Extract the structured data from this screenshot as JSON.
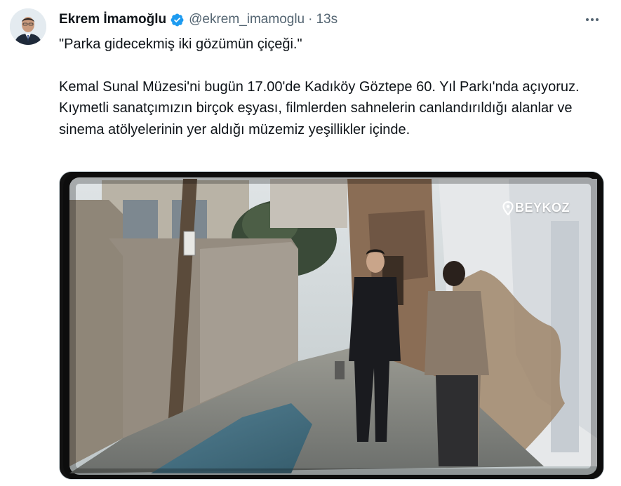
{
  "tweet": {
    "author_name": "Ekrem İmamoğlu",
    "handle": "@ekrem_imamoglu",
    "separator": "·",
    "time": "13s",
    "paragraphs": [
      "\"Parka gidecekmiş iki gözümün çiçeği.\"",
      "Kemal Sunal Müzesi'ni bugün 17.00'de Kadıköy Göztepe 60. Yıl Parkı'nda açıyoruz. Kıymetli sanatçımızın birçok eşyası, filmlerden sahnelerin canlandırıldığı alanlar ve sinema atölyelerinin yer aldığı müzemiz yeşillikler içinde."
    ]
  },
  "media": {
    "location_label": "BEYKOZ"
  },
  "icons": {
    "verified": "verified-badge-icon",
    "more": "more-horizontal-icon",
    "location": "location-pin-icon"
  },
  "colors": {
    "verified_blue": "#1d9bf0",
    "secondary_text": "#536471",
    "primary_text": "#0f1419"
  }
}
